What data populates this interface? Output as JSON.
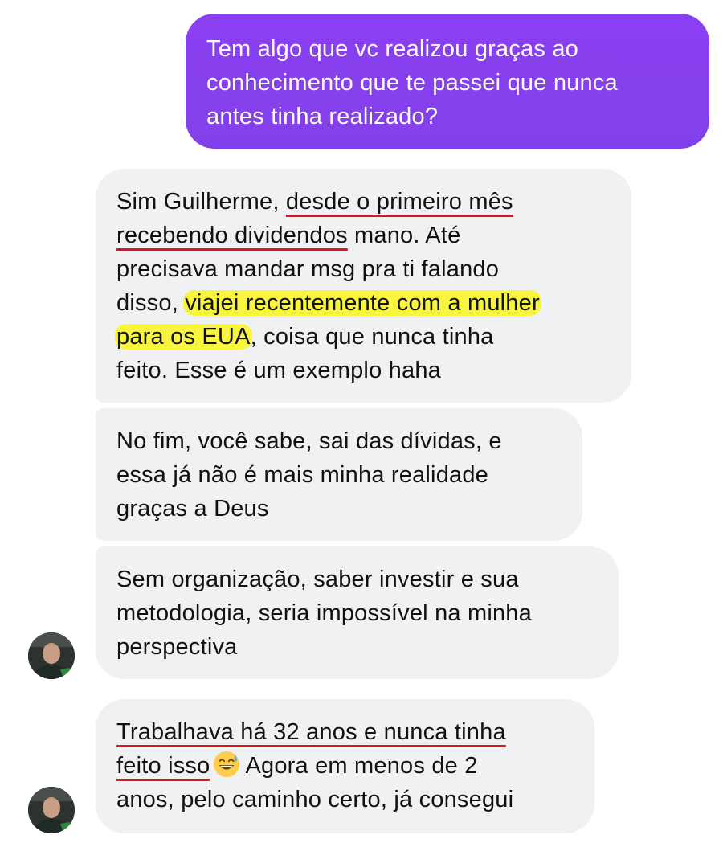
{
  "thread": {
    "sent_message": {
      "lines": [
        "Tem algo que vc realizou graças ao",
        "conhecimento que te passei que nunca",
        "antes tinha realizado?"
      ]
    },
    "received_messages": [
      {
        "lines": [
          {
            "a": "Sim Guilherme, ",
            "u": "desde o primeiro mês"
          },
          {
            "u": "recebendo dividendos",
            "b": " mano. Até"
          },
          {
            "a": "precisava mandar msg pra ti falando"
          },
          {
            "a": "disso, ",
            "h": "viajei recentemente com a mulher"
          },
          {
            "h": "para os EUA",
            "b": ", coisa que nunca tinha"
          },
          {
            "a": "feito. Esse é um exemplo haha"
          }
        ]
      },
      {
        "lines": [
          "No fim, você sabe, sai das dívidas, e",
          "essa já não é mais minha realidade",
          "graças a Deus"
        ]
      },
      {
        "lines": [
          "Sem organização, saber investir e sua",
          "metodologia, seria impossível na minha",
          "perspectiva"
        ]
      },
      {
        "lines": [
          {
            "u": "Trabalhava há 32 anos e nunca tinha"
          },
          {
            "u": "feito isso",
            "b": "Agora em menos de 2"
          },
          {
            "a": "anos, pelo caminho certo, já consegui"
          }
        ],
        "emoji": "grinning-face-with-sweat-emoji"
      }
    ],
    "highlight_color": "#f9f53f",
    "underline_color": "#e0151b",
    "sent_bubble_color": "#8a3ff0",
    "received_bubble_color": "#f0f1f3"
  }
}
